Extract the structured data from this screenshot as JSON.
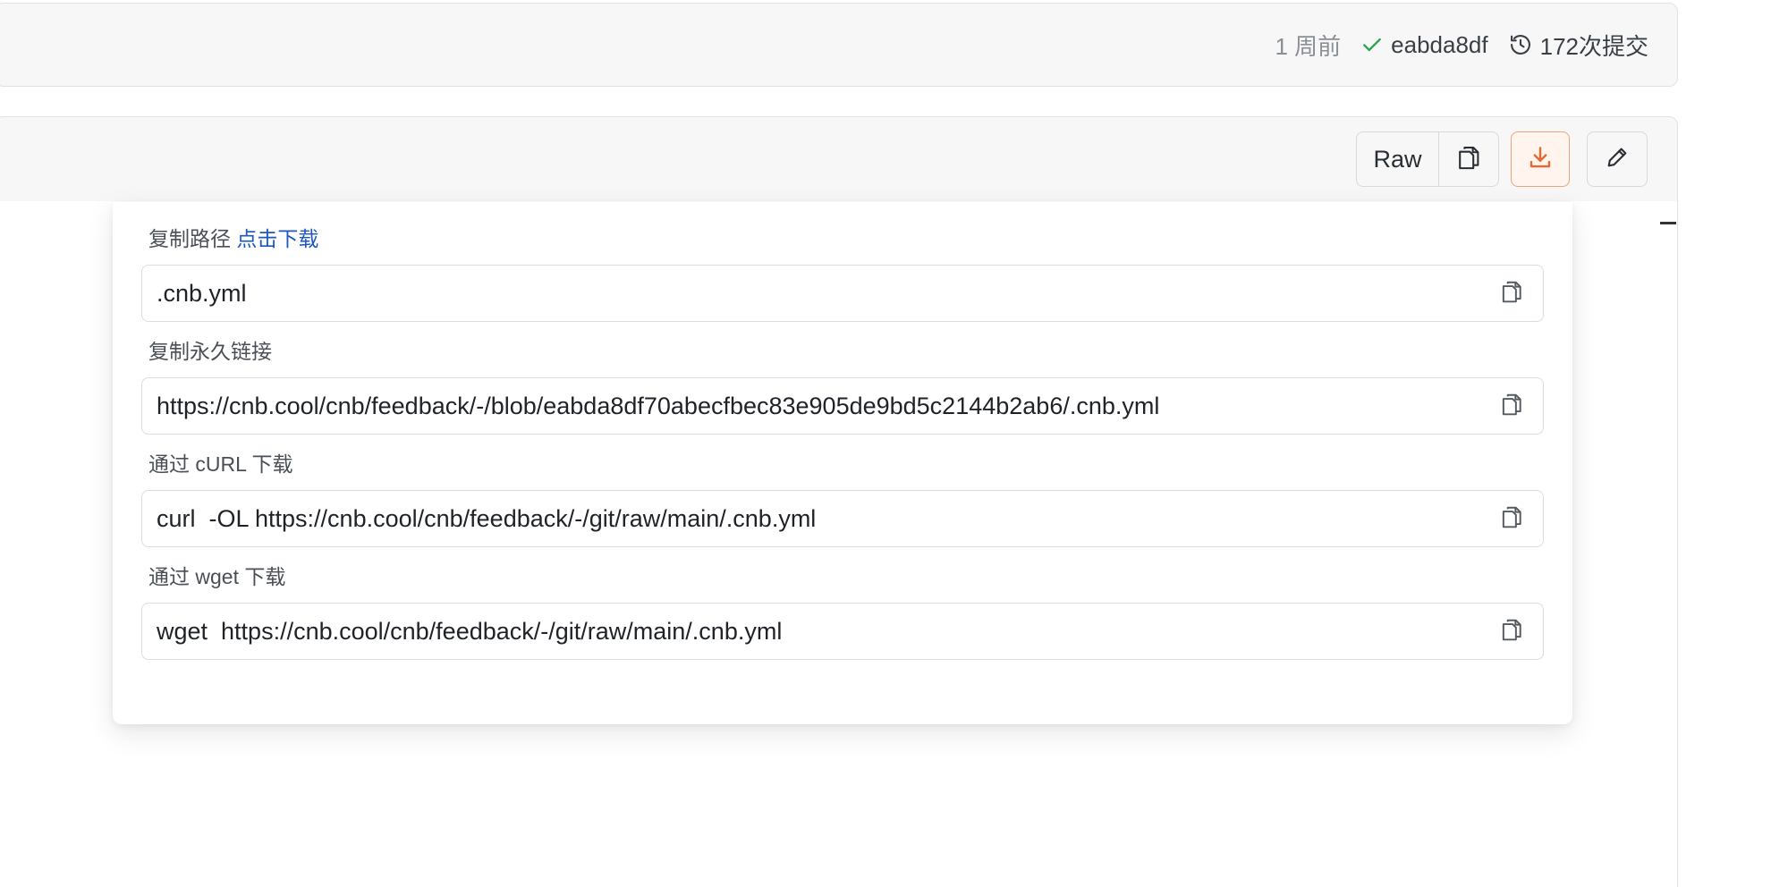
{
  "commit": {
    "time": "1 周前",
    "hash": "eabda8df",
    "count": "172次提交"
  },
  "toolbar": {
    "raw_label": "Raw"
  },
  "dropdown": {
    "copy_path": {
      "label": "复制路径",
      "link": "点击下载",
      "value": ".cnb.yml"
    },
    "permalink": {
      "label": "复制永久链接",
      "value": "https://cnb.cool/cnb/feedback/-/blob/eabda8df70abecfbec83e905de9bd5c2144b2ab6/.cnb.yml"
    },
    "curl": {
      "label": "通过 cURL 下载",
      "value": "curl  -OL https://cnb.cool/cnb/feedback/-/git/raw/main/.cnb.yml"
    },
    "wget": {
      "label": "通过 wget 下载",
      "value": "wget  https://cnb.cool/cnb/feedback/-/git/raw/main/.cnb.yml"
    }
  },
  "colors": {
    "accent_orange": "#e8692f",
    "link_blue": "#1d57c4",
    "check_green": "#2da44e"
  },
  "icons": {
    "check": "check-icon",
    "history": "history-icon",
    "copy": "copy-icon",
    "download": "download-icon",
    "edit": "pencil-icon"
  }
}
